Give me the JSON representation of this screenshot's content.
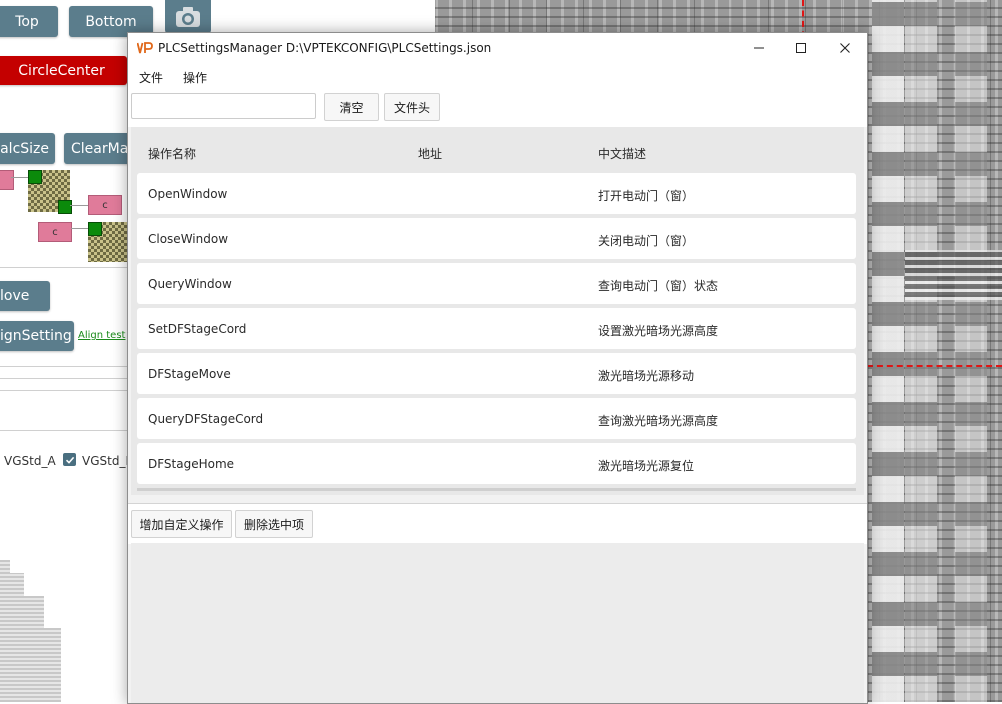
{
  "background_app": {
    "buttons": {
      "top": "Top",
      "bottom": "Bottom",
      "circle_center": "CircleCenter",
      "calc_size": "alcSize",
      "clear_mark": "ClearMar",
      "move": "love",
      "align_setting": "ignSetting"
    },
    "tag_label": "c",
    "align_test_link": "Align test",
    "checkbox_a_label": "VGStd_A",
    "checkbox_b_label": "VGStd_B",
    "checkbox_b_checked": true
  },
  "dialog": {
    "title": "PLCSettingsManager D:\\VPTEKCONFIG\\PLCSettings.json",
    "logo_text": "VP",
    "menu": [
      "文件",
      "操作"
    ],
    "toolbar": {
      "search_value": "",
      "clear_label": "清空",
      "file_header_label": "文件头"
    },
    "grid": {
      "headers": {
        "name": "操作名称",
        "address": "地址",
        "description": "中文描述"
      },
      "rows": [
        {
          "name": "OpenWindow",
          "address": "",
          "description": "打开电动门（窗）"
        },
        {
          "name": "CloseWindow",
          "address": "",
          "description": "关闭电动门（窗）"
        },
        {
          "name": "QueryWindow",
          "address": "",
          "description": "查询电动门（窗）状态"
        },
        {
          "name": "SetDFStageCord",
          "address": "",
          "description": "设置激光暗场光源高度"
        },
        {
          "name": "DFStageMove",
          "address": "",
          "description": "激光暗场光源移动"
        },
        {
          "name": "QueryDFStageCord",
          "address": "",
          "description": "查询激光暗场光源高度"
        },
        {
          "name": "DFStageHome",
          "address": "",
          "description": "激光暗场光源复位"
        }
      ]
    },
    "bottom": {
      "add_label": "增加自定义操作",
      "delete_label": "删除选中项"
    }
  },
  "colors": {
    "bg_button": "#5b7d8c",
    "circle_center_button": "#c40000",
    "logo_orange": "#e0681a",
    "wafer_dash": "#e01515"
  }
}
